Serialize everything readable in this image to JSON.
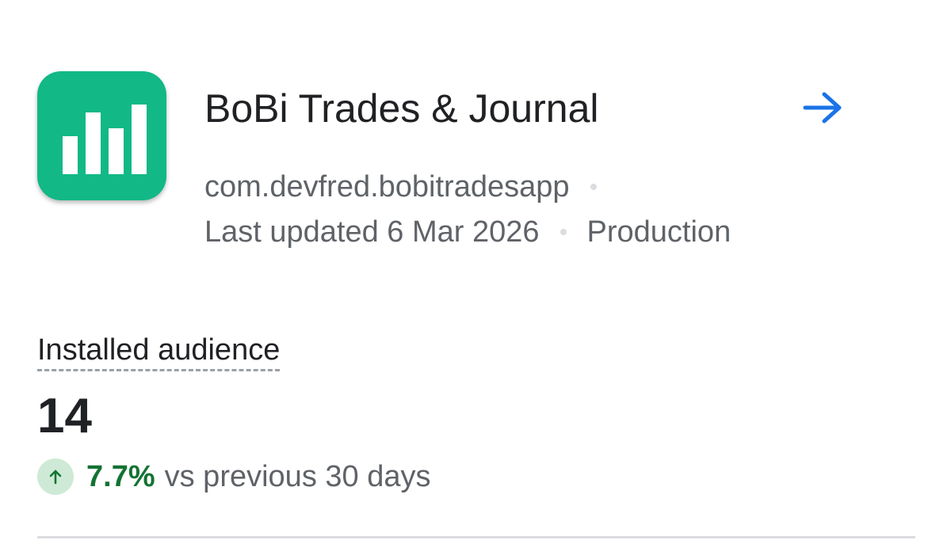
{
  "app": {
    "title": "BoBi Trades & Journal",
    "package": "com.devfred.bobitradesapp",
    "last_updated": "Last updated 6 Mar 2026",
    "track": "Production",
    "icon": "bar-chart-icon",
    "icon_color": "#12b886"
  },
  "metric": {
    "label": "Installed audience",
    "value": "14",
    "change_percent": "7.7%",
    "change_text": "vs previous 30 days",
    "trend_direction": "up",
    "trend_color": "#137333",
    "trend_badge_color": "#ceead6"
  },
  "actions": {
    "open_icon": "arrow-right-icon",
    "open_icon_color": "#1a73e8"
  }
}
